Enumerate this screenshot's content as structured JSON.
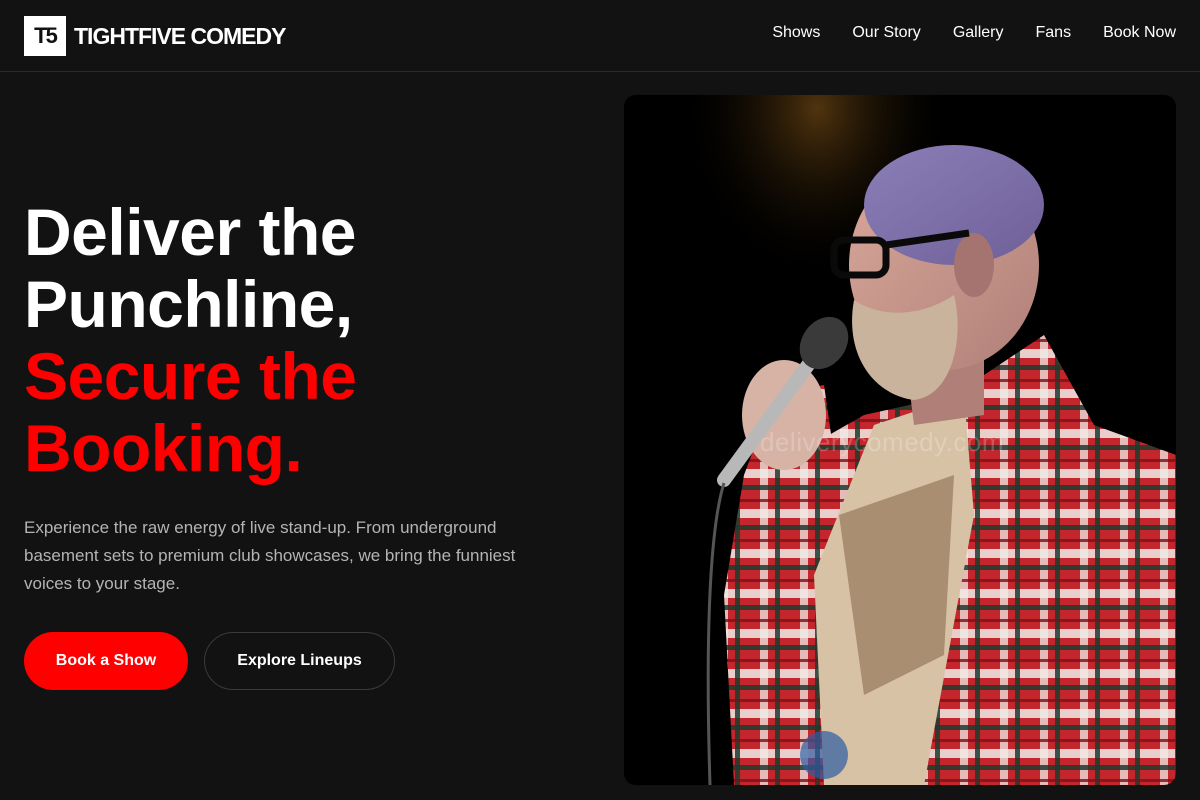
{
  "brand": {
    "logo_text": "T5",
    "name": "TIGHTFIVE COMEDY"
  },
  "nav": {
    "items": [
      {
        "label": "Shows"
      },
      {
        "label": "Our Story"
      },
      {
        "label": "Gallery"
      },
      {
        "label": "Fans"
      },
      {
        "label": "Book Now"
      }
    ]
  },
  "hero": {
    "headline_line1": "Deliver the",
    "headline_line2": "Punchline,",
    "headline_line3": "Secure the",
    "headline_line4": "Booking.",
    "lede": "Experience the raw energy of live stand-up. From underground basement sets to premium club showcases, we bring the funniest voices to your stage.",
    "primary_cta": "Book a Show",
    "secondary_cta": "Explore Lineups",
    "watermark": "deliverycomedy.com"
  },
  "colors": {
    "background": "#121212",
    "accent": "#ff0000",
    "text": "#ffffff",
    "muted_text": "#b4b4b4"
  }
}
